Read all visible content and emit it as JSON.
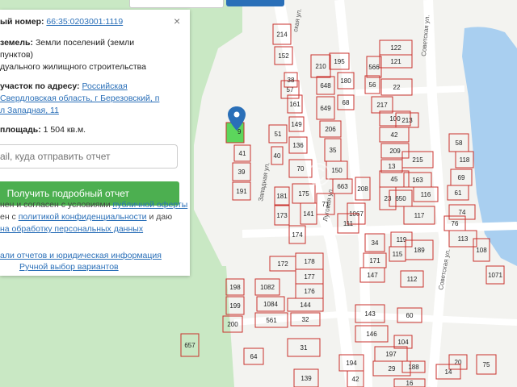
{
  "colors": {
    "parcel_border": "#c9302c",
    "selected_parcel": "#5cd65c",
    "forest": "#c9e8c4",
    "water": "#a9cff0",
    "road": "#ffffff",
    "link": "#2a6fb8",
    "button": "#4caf50",
    "marker": "#2a6fb8"
  },
  "panel": {
    "close_glyph": "×",
    "number_label": "ый номер:",
    "number_value": "66:35:0203001:1119",
    "category_label": "земель:",
    "category_value": "Земли поселений (земли",
    "category_value2": "пунктов)",
    "category_value3": "дуального жилищного строительства",
    "address_label": "участок по адресу:",
    "address_value1": "Российская",
    "address_value2": "Свердловская область, г Березовский, п",
    "address_value3": "л Западная, 11",
    "area_label": "площадь:",
    "area_value": "1 504 кв.м.",
    "email_placeholder": "ail, куда отправить отчет",
    "report_button": "Получить подробный отчет",
    "terms1_pre": "нен и согласен с условиями ",
    "terms1_link": "публичной оферты",
    "terms2_pre": "ен с ",
    "terms2_link": "политикой конфиденциальности",
    "terms2_post": " и даю",
    "terms3_link": "на обработку персональных данных",
    "example_link": "али отчетов и юридическая информация",
    "manual_link": "Ручной выбор вариантов"
  },
  "map": {
    "streets": [
      {
        "text": "Западная ул."
      },
      {
        "text": "Луговая ул."
      },
      {
        "text": "Советская ул."
      },
      {
        "text": "Советская ул."
      },
      {
        "text": "ская ул."
      }
    ],
    "parcels": [
      "214",
      "152",
      "57",
      "38",
      "161",
      "149",
      "136",
      "40",
      "70",
      "51",
      "39",
      "191",
      "181",
      "175",
      "173",
      "141",
      "174",
      "41",
      "210",
      "195",
      "648",
      "180",
      "68",
      "649",
      "206",
      "35",
      "150",
      "663",
      "208",
      "1067",
      "71",
      "111",
      "122",
      "121",
      "566",
      "56",
      "22",
      "217",
      "100",
      "213",
      "42",
      "209",
      "13",
      "215",
      "45",
      "163",
      "23",
      "650",
      "116",
      "117",
      "58",
      "118",
      "69",
      "61",
      "74",
      "76",
      "113",
      "108",
      "119",
      "115",
      "189",
      "34",
      "171",
      "147",
      "112",
      "172",
      "178",
      "177",
      "176",
      "1082",
      "1084",
      "144",
      "561",
      "32",
      "31",
      "198",
      "199",
      "200",
      "64",
      "657",
      "139",
      "143",
      "60",
      "146",
      "197",
      "104",
      "194",
      "29",
      "188",
      "16",
      "42",
      "20",
      "75",
      "14",
      "1071",
      "78"
    ],
    "selected_parcel": "11",
    "selected_parcel_neighbor": "9",
    "watermark": "©"
  }
}
